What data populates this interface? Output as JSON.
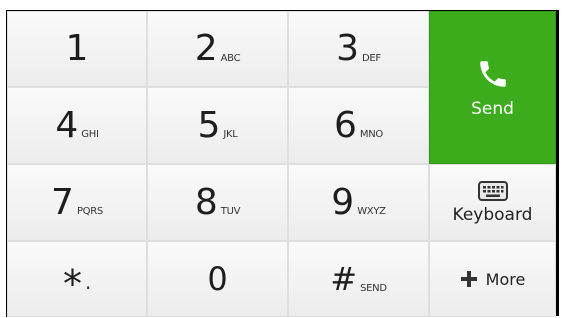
{
  "keys": [
    {
      "digit": "1",
      "letters": ""
    },
    {
      "digit": "2",
      "letters": "ABC"
    },
    {
      "digit": "3",
      "letters": "DEF"
    },
    {
      "digit": "4",
      "letters": "GHI"
    },
    {
      "digit": "5",
      "letters": "JKL"
    },
    {
      "digit": "6",
      "letters": "MNO"
    },
    {
      "digit": "7",
      "letters": "PQRS"
    },
    {
      "digit": "8",
      "letters": "TUV"
    },
    {
      "digit": "9",
      "letters": "WXYZ"
    },
    {
      "digit": "*",
      "letters": "."
    },
    {
      "digit": "0",
      "letters": ""
    },
    {
      "digit": "#",
      "letters": "SEND"
    }
  ],
  "send": {
    "label": "Send",
    "icon": "phone-icon"
  },
  "keyboard": {
    "label": "Keyboard",
    "icon": "keyboard-icon"
  },
  "more": {
    "label": "More",
    "icon": "plus-icon"
  },
  "colors": {
    "send_green": "#3cac1c",
    "key_bg": "#f4f4f4",
    "border": "#000000"
  }
}
